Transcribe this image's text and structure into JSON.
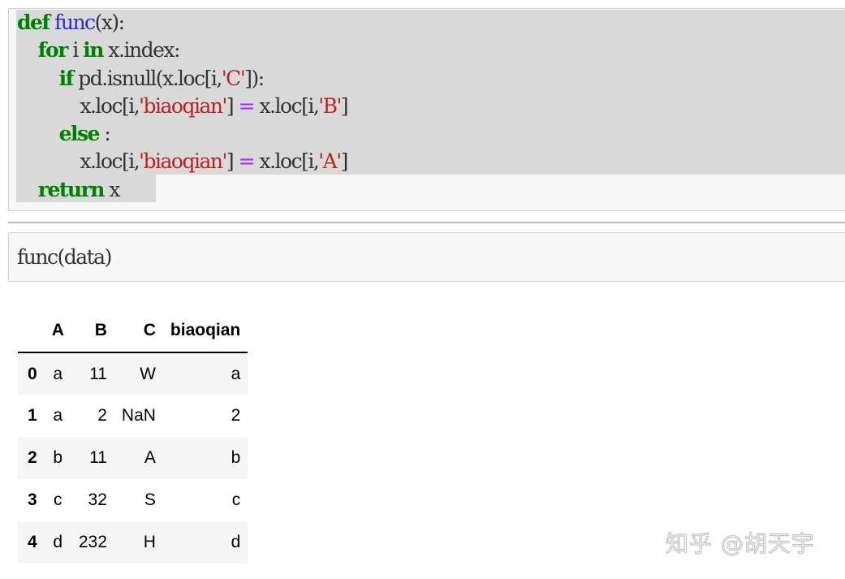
{
  "code_cell_1": {
    "lines": [
      [
        {
          "t": "def",
          "c": "kw"
        },
        {
          "t": " ",
          "c": "tx"
        },
        {
          "t": "func",
          "c": "fn"
        },
        {
          "t": "(x):",
          "c": "tx"
        }
      ],
      [
        {
          "t": "    ",
          "c": "tx"
        },
        {
          "t": "for",
          "c": "kw"
        },
        {
          "t": " i ",
          "c": "tx"
        },
        {
          "t": "in",
          "c": "kw"
        },
        {
          "t": " x.index:",
          "c": "tx"
        }
      ],
      [
        {
          "t": "        ",
          "c": "tx"
        },
        {
          "t": "if",
          "c": "kw"
        },
        {
          "t": " pd.isnull(x.loc[i,",
          "c": "tx"
        },
        {
          "t": "'C'",
          "c": "st"
        },
        {
          "t": "]):",
          "c": "tx"
        }
      ],
      [
        {
          "t": "            x.loc[i,",
          "c": "tx"
        },
        {
          "t": "'biaoqian'",
          "c": "st"
        },
        {
          "t": "] ",
          "c": "tx"
        },
        {
          "t": "=",
          "c": "op"
        },
        {
          "t": " x.loc[i,",
          "c": "tx"
        },
        {
          "t": "'B'",
          "c": "st"
        },
        {
          "t": "]",
          "c": "tx"
        }
      ],
      [
        {
          "t": "        ",
          "c": "tx"
        },
        {
          "t": "else",
          "c": "kw"
        },
        {
          "t": " :",
          "c": "tx"
        }
      ],
      [
        {
          "t": "            x.loc[i,",
          "c": "tx"
        },
        {
          "t": "'biaoqian'",
          "c": "st"
        },
        {
          "t": "] ",
          "c": "tx"
        },
        {
          "t": "=",
          "c": "op"
        },
        {
          "t": " x.loc[i,",
          "c": "tx"
        },
        {
          "t": "'A'",
          "c": "st"
        },
        {
          "t": "]",
          "c": "tx"
        }
      ],
      [
        {
          "t": "    ",
          "c": "tx"
        },
        {
          "t": "return",
          "c": "kw"
        },
        {
          "t": " x",
          "c": "tx"
        }
      ]
    ]
  },
  "code_cell_2": {
    "code": "func(data)"
  },
  "dataframe": {
    "columns": [
      "",
      "A",
      "B",
      "C",
      "biaoqian"
    ],
    "rows": [
      {
        "index": "0",
        "A": "a",
        "B": "11",
        "C": "W",
        "biaoqian": "a"
      },
      {
        "index": "1",
        "A": "a",
        "B": "2",
        "C": "NaN",
        "biaoqian": "2"
      },
      {
        "index": "2",
        "A": "b",
        "B": "11",
        "C": "A",
        "biaoqian": "b"
      },
      {
        "index": "3",
        "A": "c",
        "B": "32",
        "C": "S",
        "biaoqian": "c"
      },
      {
        "index": "4",
        "A": "d",
        "B": "232",
        "C": "H",
        "biaoqian": "d"
      }
    ]
  },
  "watermark": {
    "text": "知乎 @胡天宇"
  },
  "colors": {
    "keyword": "#008000",
    "function_name": "#2b2bd1",
    "string": "#ba2121",
    "operator": "#aa22ff",
    "text": "#333333",
    "selection": "#d9d9d9",
    "cell_background": "#f7f7f7"
  }
}
